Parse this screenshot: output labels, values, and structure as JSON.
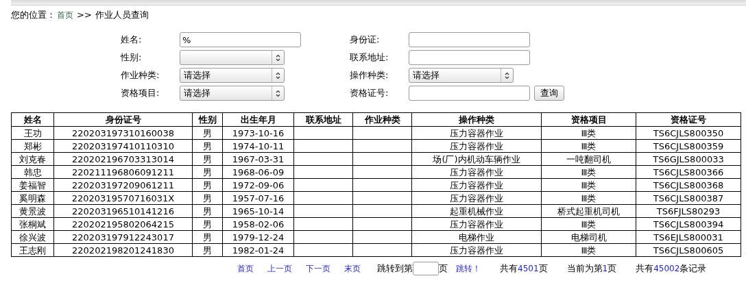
{
  "breadcrumb": {
    "label": "您的位置：",
    "home": "首页",
    "separator": ">>",
    "current": "作业人员查询"
  },
  "form": {
    "fields": [
      {
        "label": "姓名:",
        "kind": "text",
        "value": "%"
      },
      {
        "label": "身份证:",
        "kind": "text"
      },
      {
        "label": "性别:",
        "kind": "select"
      },
      {
        "label": "联系地址:",
        "kind": "text"
      },
      {
        "label": "作业种类:",
        "kind": "select",
        "value": "请选择"
      },
      {
        "label": "操作种类:",
        "kind": "select",
        "value": "请选择"
      },
      {
        "label": "资格项目:",
        "kind": "select",
        "value": "请选择"
      },
      {
        "label": "资格证号:",
        "kind": "text"
      }
    ],
    "submit": "查询"
  },
  "table": {
    "columns": [
      "姓名",
      "身份证号",
      "性别",
      "出生年月",
      "联系地址",
      "作业种类",
      "操作种类",
      "资格项目",
      "资格证号"
    ],
    "rows": [
      [
        "王功",
        "220203197310160038",
        "男",
        "1973-10-16",
        "",
        "",
        "压力容器作业",
        "Ⅲ类",
        "TS6CJLS800350"
      ],
      [
        "郑彬",
        "220203197410110310",
        "男",
        "1974-10-11",
        "",
        "",
        "压力容器作业",
        "Ⅲ类",
        "TS6CJLS800359"
      ],
      [
        "刘克春",
        "220202196703313014",
        "男",
        "1967-03-31",
        "",
        "",
        "场(厂)内机动车辆作业",
        "一吨翻司机",
        "TS6GJLS800033"
      ],
      [
        "韩忠",
        "220211196806091211",
        "男",
        "1968-06-09",
        "",
        "",
        "压力容器作业",
        "Ⅲ类",
        "TS6CJLS800366"
      ],
      [
        "姜福智",
        "220203197209061211",
        "男",
        "1972-09-06",
        "",
        "",
        "压力容器作业",
        "Ⅲ类",
        "TS6CJLS800368"
      ],
      [
        "奚明森",
        "22020319570716031X",
        "男",
        "1957-07-16",
        "",
        "",
        "压力容器作业",
        "Ⅲ类",
        "TS6CJLS800387"
      ],
      [
        "黄景波",
        "220203196510141216",
        "男",
        "1965-10-14",
        "",
        "",
        "起重机械作业",
        "桥式起重机司机",
        "TS6FJLS80293"
      ],
      [
        "张桐斌",
        "220202195802064215",
        "男",
        "1958-02-06",
        "",
        "",
        "压力容器作业",
        "Ⅲ类",
        "TS6CJLS800394"
      ],
      [
        "徐兴波",
        "220203197912243017",
        "男",
        "1979-12-24",
        "",
        "",
        "电梯作业",
        "电梯司机",
        "TS6EJLS800031"
      ],
      [
        "王志刚",
        "220202198201241830",
        "男",
        "1982-01-24",
        "",
        "",
        "压力容器作业",
        "Ⅲ类",
        "TS6CJLS800605"
      ]
    ]
  },
  "pagination": {
    "links": [
      "首页",
      "上一页",
      "下一页",
      "末页"
    ],
    "jump_prefix": "跳转到第",
    "jump_suffix": "页",
    "jump_button": "跳转！",
    "stats": [
      {
        "prefix": "共有",
        "value": "4501",
        "suffix": "页"
      },
      {
        "prefix": "当前为第",
        "value": "1",
        "suffix": "页"
      },
      {
        "prefix": "共有",
        "value": "45002",
        "suffix": "条记录"
      }
    ]
  }
}
